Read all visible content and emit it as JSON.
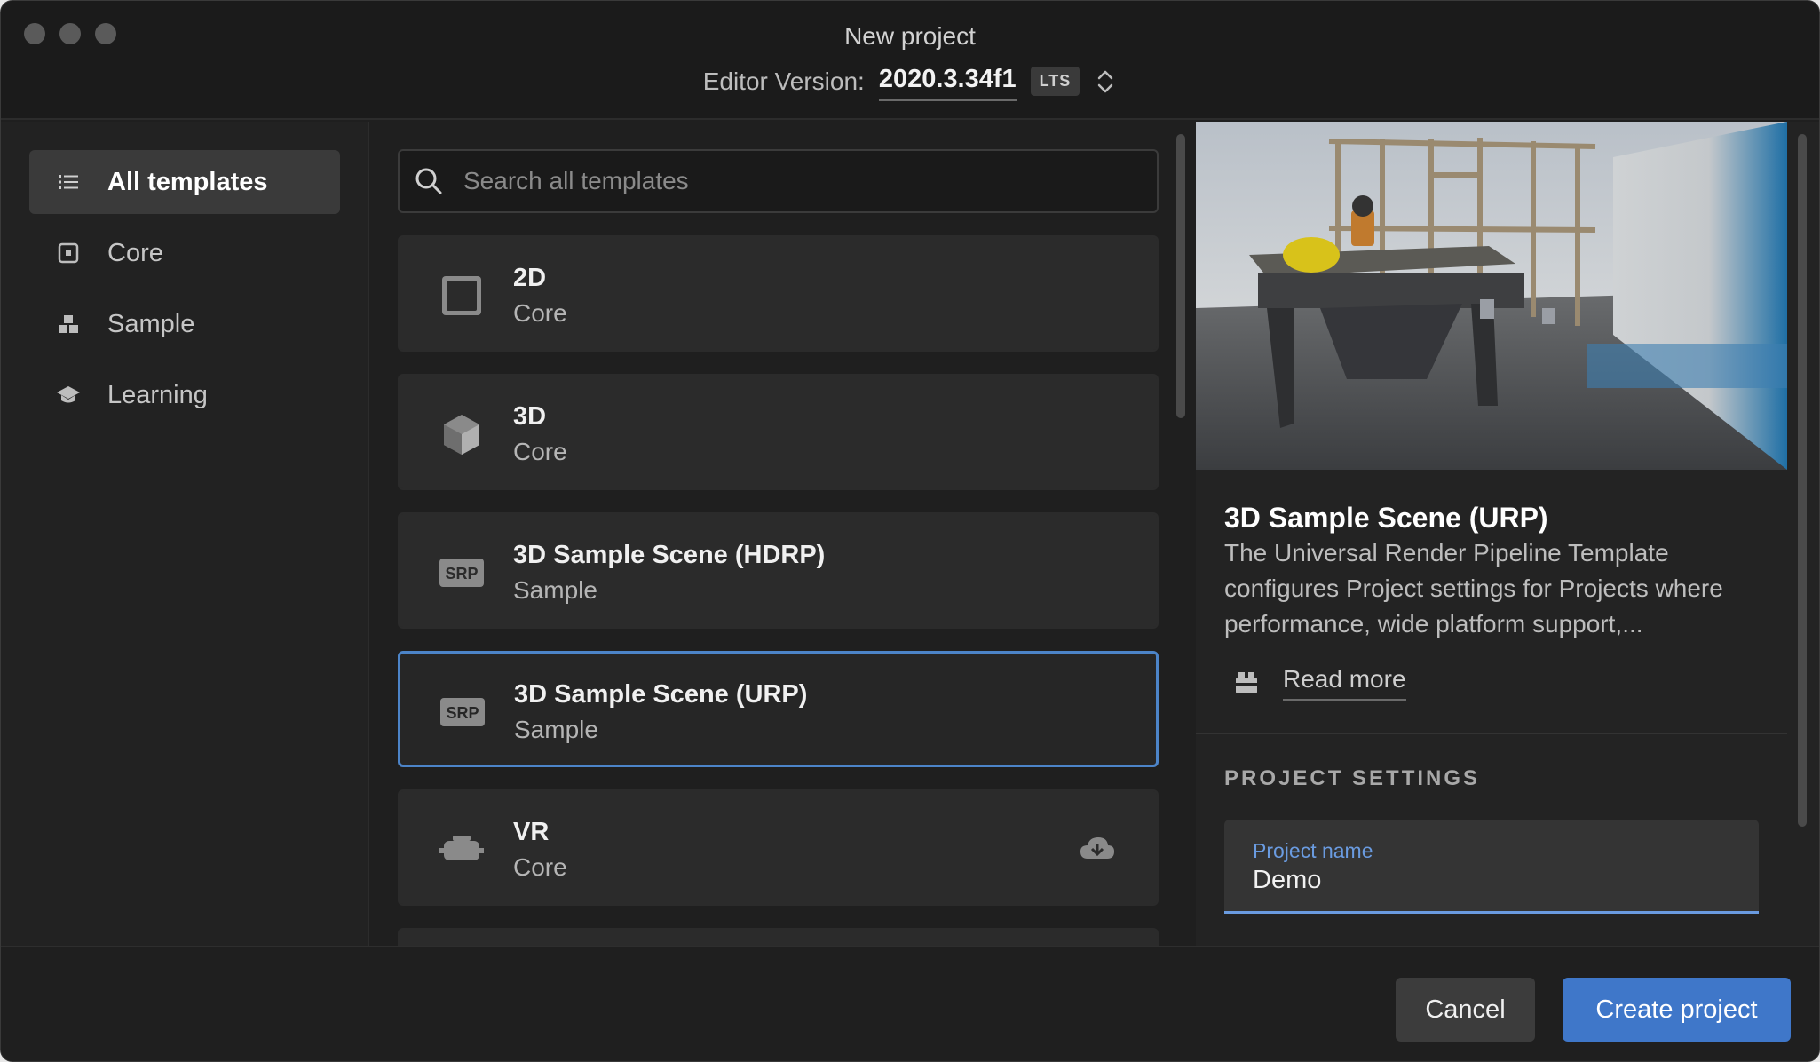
{
  "window": {
    "title": "New project",
    "editor_version_label": "Editor Version:",
    "editor_version": "2020.3.34f1",
    "version_badge": "LTS"
  },
  "sidebar": {
    "items": [
      {
        "label": "All templates",
        "icon": "list-icon",
        "active": true
      },
      {
        "label": "Core",
        "icon": "core-square-icon",
        "active": false
      },
      {
        "label": "Sample",
        "icon": "sample-blocks-icon",
        "active": false
      },
      {
        "label": "Learning",
        "icon": "graduation-cap-icon",
        "active": false
      }
    ]
  },
  "search": {
    "placeholder": "Search all templates",
    "value": ""
  },
  "templates": [
    {
      "title": "2D",
      "category": "Core",
      "icon": "square-2d-icon"
    },
    {
      "title": "3D",
      "category": "Core",
      "icon": "cube-3d-icon"
    },
    {
      "title": "3D Sample Scene (HDRP)",
      "category": "Sample",
      "icon": "srp-icon"
    },
    {
      "title": "3D Sample Scene (URP)",
      "category": "Sample",
      "icon": "srp-icon",
      "selected": true
    },
    {
      "title": "VR",
      "category": "Core",
      "icon": "vr-headset-icon",
      "download": "cloud-download-icon"
    }
  ],
  "detail": {
    "title": "3D Sample Scene (URP)",
    "description": "The Universal Render Pipeline Template configures Project settings for Projects where performance, wide platform support,...",
    "read_more": "Read more",
    "settings_heading": "PROJECT SETTINGS",
    "project_name_label": "Project name",
    "project_name_value": "Demo"
  },
  "footer": {
    "cancel_label": "Cancel",
    "create_label": "Create project"
  },
  "colors": {
    "accent": "#3f77c9",
    "selection_border": "#4c84c8",
    "field_accent": "#6a9be0"
  }
}
